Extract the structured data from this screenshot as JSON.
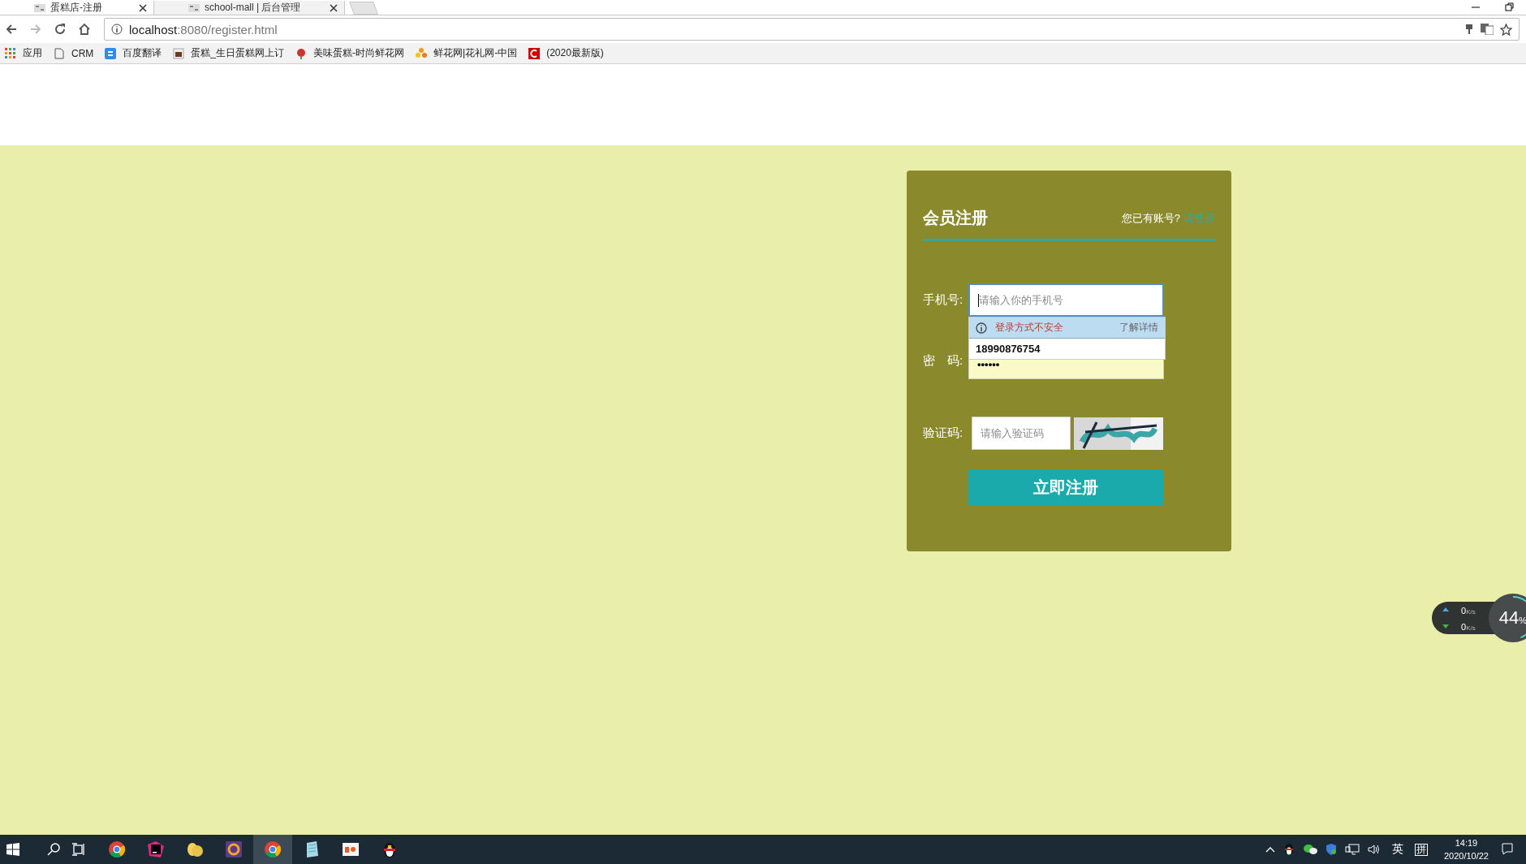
{
  "browser": {
    "tabs": [
      {
        "title": "蛋糕店-注册",
        "selected": true
      },
      {
        "title": "school-mall | 后台管理",
        "selected": false
      }
    ],
    "address": {
      "host": "localhost",
      "path": ":8080/register.html"
    },
    "bookmarks": [
      {
        "label": "应用",
        "kind": "apps"
      },
      {
        "label": "CRM",
        "kind": "page"
      },
      {
        "label": "百度翻译",
        "kind": "translate"
      },
      {
        "label": "蛋糕_生日蛋糕网上订",
        "kind": "cake"
      },
      {
        "label": "美味蛋糕-时尚鲜花网",
        "kind": "rose"
      },
      {
        "label": "鲜花网|花礼网-中国",
        "kind": "flower"
      },
      {
        "label": "(2020最新版)",
        "kind": "c"
      }
    ]
  },
  "register": {
    "title": "会员注册",
    "login_prompt": "您已有账号?",
    "login_link": "请登录",
    "fields": [
      {
        "label": "手机号:",
        "placeholder": "请输入你的手机号",
        "focused": true,
        "autofilled": false
      },
      {
        "label": "密　码:",
        "value": "••••••",
        "focused": false,
        "autofilled": true
      }
    ],
    "autofill": {
      "warning": "登录方式不安全",
      "details": "了解详情",
      "suggestion": "18990876754"
    },
    "captcha": {
      "label": "验证码:",
      "placeholder": "请输入验证码"
    },
    "submit": "立即注册"
  },
  "speed_widget": {
    "upload": "0",
    "upload_unit": "K/s",
    "download": "0",
    "download_unit": "K/s",
    "percent": "44",
    "percent_sign": "%",
    "level": 0.44
  },
  "taskbar": {
    "apps": [
      {
        "kind": "chrome",
        "selected": false
      },
      {
        "kind": "intellij",
        "selected": false
      },
      {
        "kind": "yellow",
        "selected": false
      },
      {
        "kind": "javaee",
        "selected": false
      },
      {
        "kind": "chrome",
        "selected": true
      },
      {
        "kind": "notepad",
        "selected": false
      },
      {
        "kind": "presenter",
        "selected": false
      },
      {
        "kind": "penguin",
        "selected": false
      }
    ],
    "tray": {
      "ime_lang": "英",
      "ime_mode": "拼",
      "time": "14:19",
      "date": "2020/10/22"
    }
  }
}
